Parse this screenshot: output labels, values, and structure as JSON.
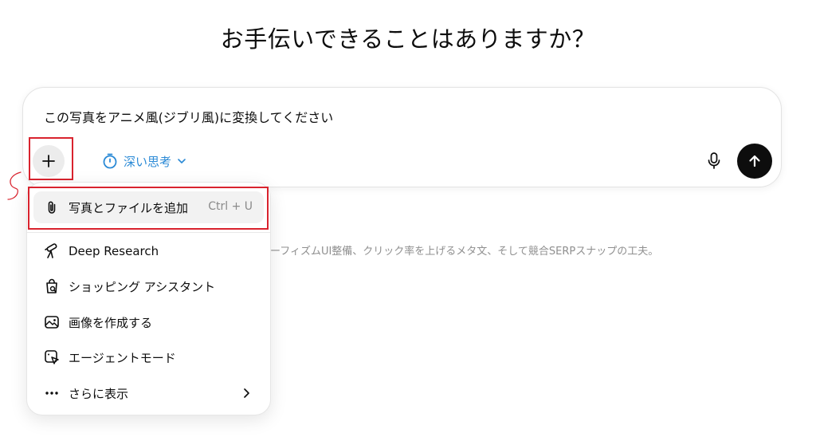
{
  "heading": "お手伝いできることはありますか？",
  "composer": {
    "prompt_text": "この写真をアニメ風(ジブリ風)に変換してください",
    "mode_label": "深い思考"
  },
  "background_text": "スモーフィズムUI整備、クリック率を上げるメタ文、そして競合SERPスナップの工夫。",
  "menu": {
    "items": [
      {
        "label": "写真とファイルを追加",
        "shortcut": "Ctrl + U",
        "icon": "paperclip-icon"
      },
      {
        "label": "Deep Research",
        "icon": "telescope-icon"
      },
      {
        "label": "ショッピング アシスタント",
        "icon": "shopping-bag-search-icon"
      },
      {
        "label": "画像を作成する",
        "icon": "image-create-icon"
      },
      {
        "label": "エージェントモード",
        "icon": "agent-cursor-icon"
      },
      {
        "label": "さらに表示",
        "icon": "ellipsis-icon"
      }
    ]
  },
  "colors": {
    "accent": "#2b8ad6",
    "highlight": "#d9232e",
    "send_button": "#0d0d0d"
  }
}
